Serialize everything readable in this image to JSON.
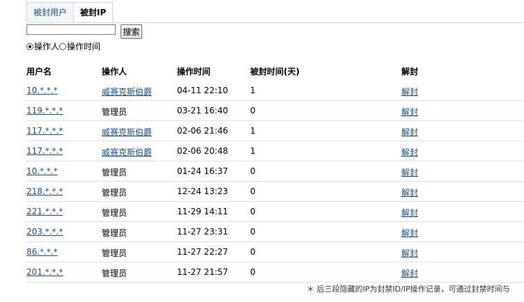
{
  "tabs": [
    "被封用户",
    "被封IP"
  ],
  "search": {
    "value": "",
    "button": "搜索"
  },
  "radios": [
    {
      "label": "操作人",
      "checked": true
    },
    {
      "label": "操作时间",
      "checked": false
    }
  ],
  "columns": [
    "用户名",
    "操作人",
    "操作时间",
    "被封时间(天)",
    "解封"
  ],
  "rows": [
    {
      "ip": "10.*.*.*",
      "operator": "威赛克斯伯爵",
      "operator_link": true,
      "time": "04-11 22:10",
      "days": "1",
      "action": "解封"
    },
    {
      "ip": "119.*.*.*",
      "operator": "管理员",
      "operator_link": false,
      "time": "03-21 16:40",
      "days": "0",
      "action": "解封"
    },
    {
      "ip": "117.*.*.*",
      "operator": "威赛克斯伯爵",
      "operator_link": true,
      "time": "02-06 21:46",
      "days": "1",
      "action": "解封"
    },
    {
      "ip": "117.*.*.*",
      "operator": "威赛克斯伯爵",
      "operator_link": true,
      "time": "02-06 20:48",
      "days": "1",
      "action": "解封"
    },
    {
      "ip": "10.*.*.*",
      "operator": "管理员",
      "operator_link": false,
      "time": "01-24 16:37",
      "days": "0",
      "action": "解封"
    },
    {
      "ip": "218.*.*.*",
      "operator": "管理员",
      "operator_link": false,
      "time": "12-24 13:23",
      "days": "0",
      "action": "解封"
    },
    {
      "ip": "221.*.*.*",
      "operator": "管理员",
      "operator_link": false,
      "time": "11-29 14:11",
      "days": "0",
      "action": "解封"
    },
    {
      "ip": "203.*.*.*",
      "operator": "管理员",
      "operator_link": false,
      "time": "11-27 23:31",
      "days": "0",
      "action": "解封"
    },
    {
      "ip": "86.*.*.*",
      "operator": "管理员",
      "operator_link": false,
      "time": "11-27 22:27",
      "days": "0",
      "action": "解封"
    },
    {
      "ip": "201.*.*.*",
      "operator": "管理员",
      "operator_link": false,
      "time": "11-27 21:57",
      "days": "0",
      "action": "解封"
    }
  ],
  "footnote": "＊ 后三段隐藏的IP为封禁ID/IP操作记录，可通过封禁时间与"
}
